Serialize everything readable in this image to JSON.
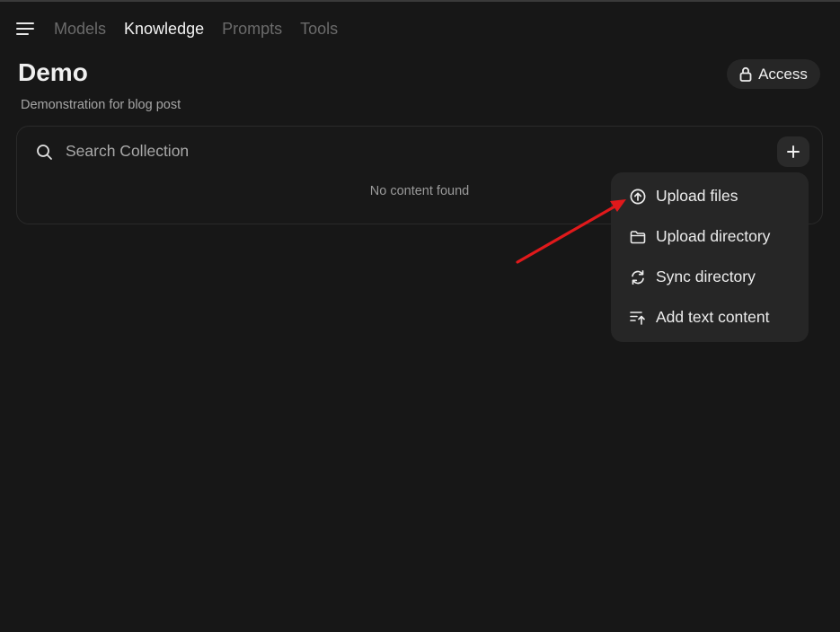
{
  "nav": {
    "menu_icon": "hamburger-menu-icon",
    "tabs": [
      {
        "label": "Models",
        "active": false
      },
      {
        "label": "Knowledge",
        "active": true
      },
      {
        "label": "Prompts",
        "active": false
      },
      {
        "label": "Tools",
        "active": false
      }
    ]
  },
  "page": {
    "title": "Demo",
    "subtitle": "Demonstration for blog post"
  },
  "access": {
    "label": "Access",
    "icon": "lock-icon"
  },
  "collection": {
    "search_placeholder": "Search Collection",
    "empty_text": "No content found",
    "add_icon": "plus-icon"
  },
  "add_menu": {
    "items": [
      {
        "label": "Upload files",
        "icon": "upload-circle-icon"
      },
      {
        "label": "Upload directory",
        "icon": "folder-icon"
      },
      {
        "label": "Sync directory",
        "icon": "sync-icon"
      },
      {
        "label": "Add text content",
        "icon": "text-add-icon"
      }
    ]
  },
  "colors": {
    "background": "#171717",
    "surface": "#262626",
    "annotation_arrow": "#e0191b"
  }
}
